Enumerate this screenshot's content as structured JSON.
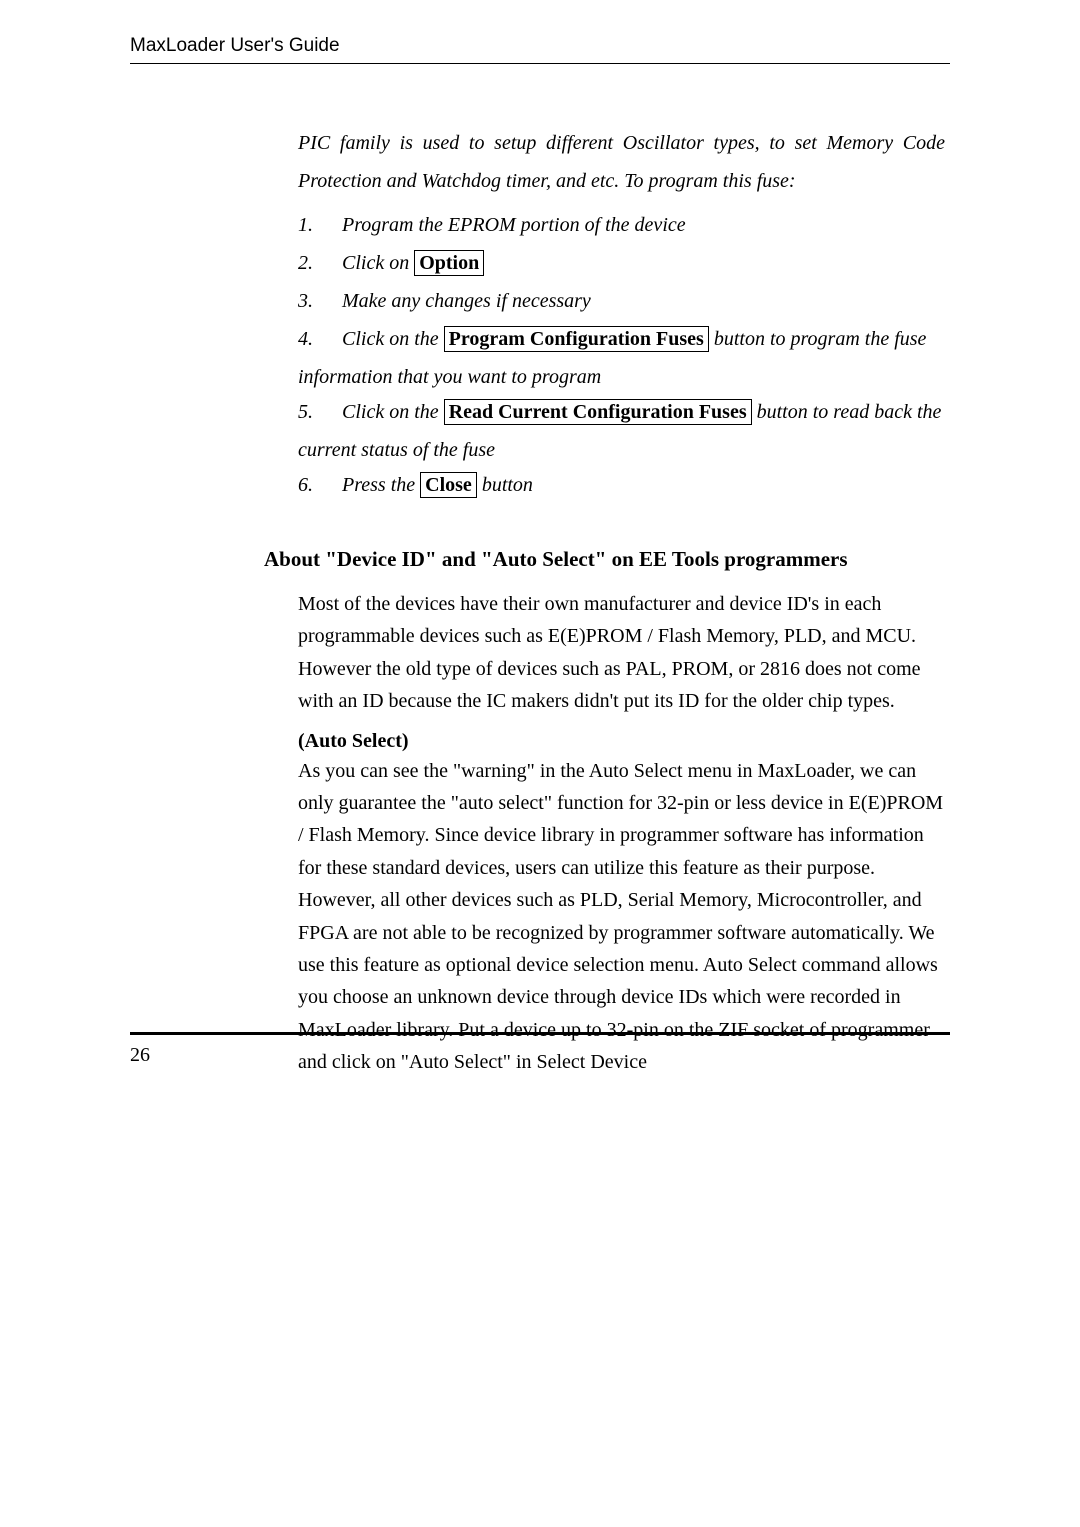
{
  "header": {
    "title": "MaxLoader User's Guide"
  },
  "intro": {
    "text": "PIC family is used to setup different Oscillator types, to set Memory Code Protection and Watchdog timer, and  etc.   To program this fuse:"
  },
  "steps": {
    "s1": {
      "num": "1.",
      "text": "Program the EPROM portion of the device"
    },
    "s2": {
      "num": "2.",
      "prefix": "Click on  ",
      "boxed": "Option"
    },
    "s3": {
      "num": "3.",
      "text": "Make any changes if necessary"
    },
    "s4": {
      "num": "4.",
      "prefix": "Click on the ",
      "boxed": "Program Configuration Fuses",
      "suffix": " button to program the fuse",
      "cont": "information that you want to program"
    },
    "s5": {
      "num": "5.",
      "prefix": "Click on the ",
      "boxed": "Read Current Configuration Fuses",
      "suffix": " button to read back the",
      "cont": "current status of the fuse"
    },
    "s6": {
      "num": "6.",
      "prefix": "Press the ",
      "boxed": "Close",
      "suffix": " button"
    }
  },
  "section": {
    "heading": "About \"Device ID\" and \"Auto Select\" on EE Tools programmers",
    "para1": "Most of the devices have their own manufacturer and device ID's in each programmable devices such as E(E)PROM / Flash Memory, PLD, and MCU. However the old type of devices such as PAL, PROM, or 2816 does not come with an ID because the IC makers didn't put its ID for the older chip types.",
    "subheading": "(Auto Select)",
    "para2": "As you can see the \"warning\" in the Auto Select menu in MaxLoader, we can only guarantee the \"auto select\" function for 32-pin or less device in E(E)PROM  / Flash Memory. Since device library in programmer software has information for these standard devices, users can utilize this feature as their purpose. However, all other devices such as PLD, Serial Memory, Microcontroller, and FPGA are not able to be recognized by programmer software automatically. We use this feature as optional device selection menu. Auto Select command allows you choose an unknown device through device IDs which were recorded in MaxLoader library.  Put a device up to 32-pin on the ZIF socket of programmer and click on \"Auto Select\" in Select Device"
  },
  "footer": {
    "page_number": "26"
  }
}
